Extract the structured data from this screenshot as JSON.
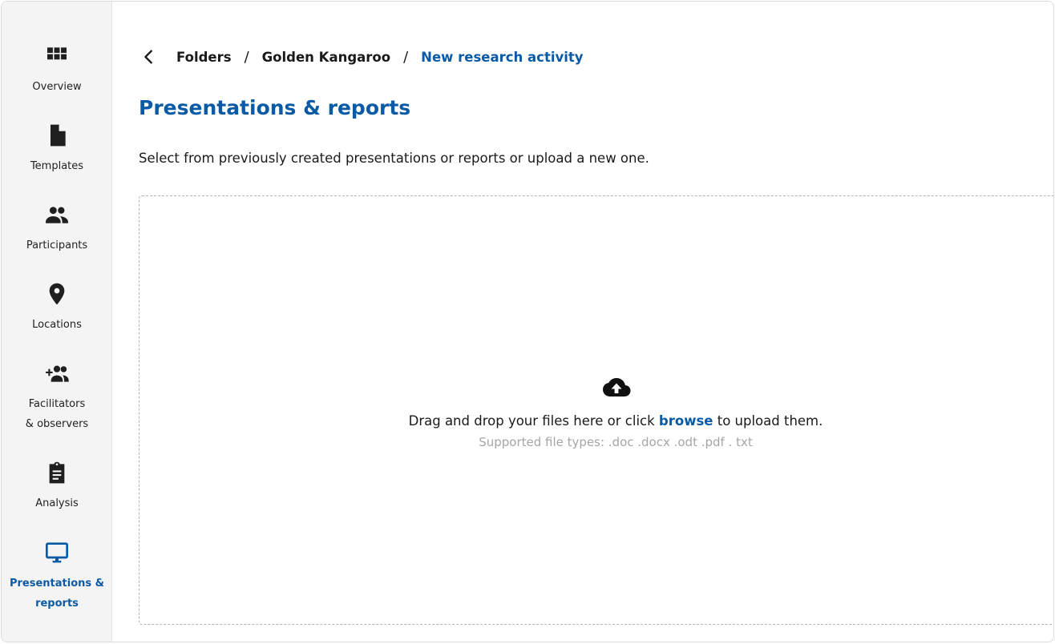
{
  "sidebar": {
    "items": [
      {
        "label": "Overview",
        "icon": "grid-icon"
      },
      {
        "label": "Templates",
        "icon": "document-icon"
      },
      {
        "label": "Participants",
        "icon": "people-icon"
      },
      {
        "label": "Locations",
        "icon": "location-pin-icon"
      },
      {
        "label_line1": "Facilitators",
        "label_line2": "& observers",
        "icon": "add-people-icon"
      },
      {
        "label": "Analysis",
        "icon": "clipboard-icon"
      },
      {
        "label_line1": "Presentations &",
        "label_line2": "reports",
        "icon": "monitor-icon",
        "active": true
      }
    ]
  },
  "breadcrumb": {
    "items": [
      "Folders",
      "Golden Kangaroo",
      "New research activity"
    ],
    "separator": "/"
  },
  "page": {
    "title": "Presentations & reports",
    "description": "Select from previously created presentations or reports or upload a new one."
  },
  "dropzone": {
    "text_before": "Drag and drop your files here or click",
    "browse_label": "browse",
    "text_after": "to upload them.",
    "hint": "Supported file types: .doc .docx .odt .pdf . txt"
  },
  "colors": {
    "accent": "#0b5aa5",
    "sidebar_bg": "#f4f4f4",
    "hint_text": "#a6a6a6"
  }
}
